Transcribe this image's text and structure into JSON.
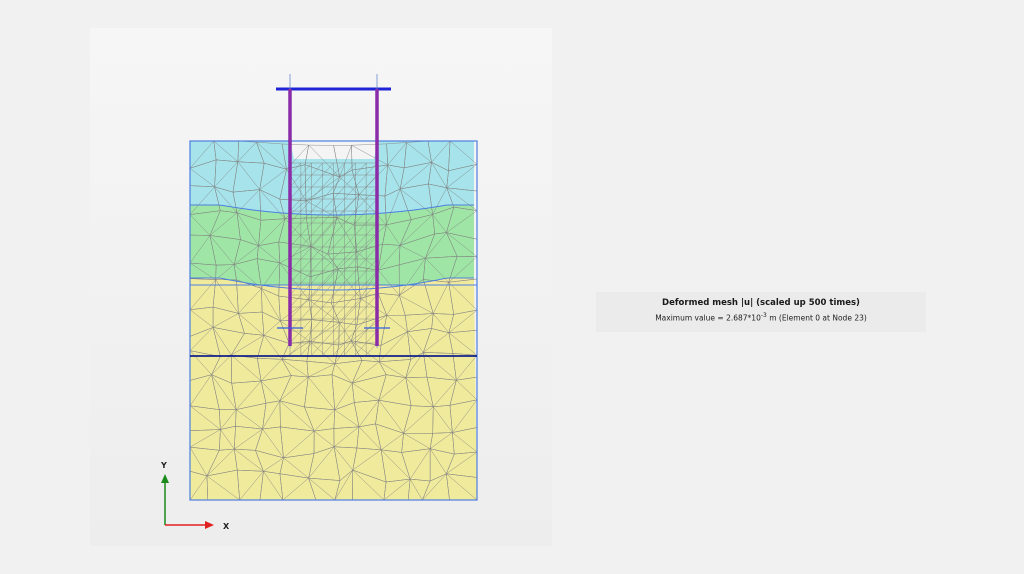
{
  "viewport": {
    "layers": [
      {
        "name": "layer-1",
        "color": "#a6e3ea"
      },
      {
        "name": "layer-2",
        "color": "#9fe6a6"
      },
      {
        "name": "layer-3",
        "color": "#f0ea9d"
      },
      {
        "name": "layer-4",
        "color": "#f0ea9d"
      }
    ],
    "mesh_color": "#7f7f7f",
    "boundary_color": "#4c7fe0",
    "pile_color": "#8a2ca8",
    "beam_color": "#1f23d6",
    "axes": {
      "x_label": "X",
      "y_label": "Y",
      "x_color": "#e02020",
      "y_color": "#1a8a1a"
    }
  },
  "caption": {
    "title": "Deformed mesh |u| (scaled up 500 times)",
    "max_prefix": "Maximum value = 2.687*10",
    "max_exponent": "-3",
    "max_suffix": " m (Element 0 at Node 23)"
  }
}
